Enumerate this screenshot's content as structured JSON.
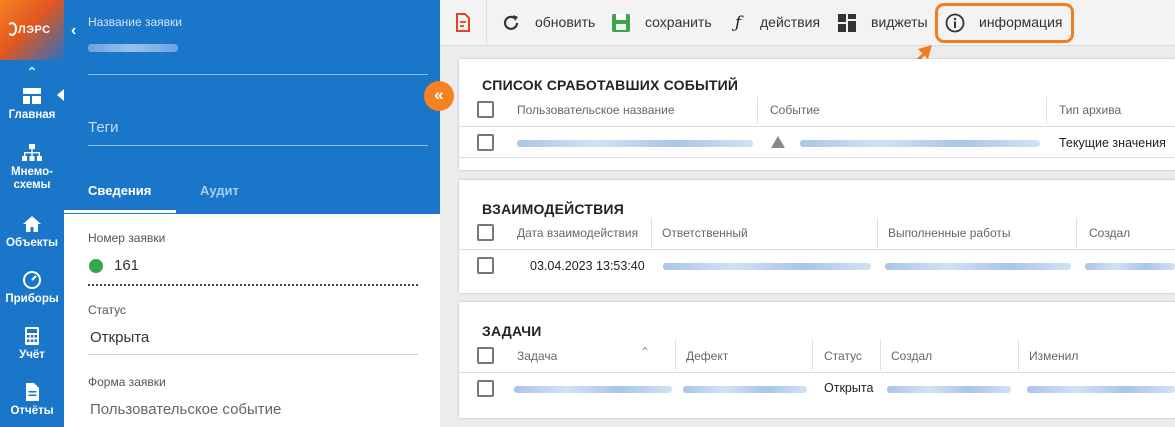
{
  "colors": {
    "primary": "#1976c8",
    "accent": "#f58220",
    "status_open": "#2fa84f",
    "highlight": "#f07d1e"
  },
  "logo": {
    "text": "ЛЭРС"
  },
  "nav": {
    "items": [
      {
        "label": "Главная",
        "icon": "dashboard-icon"
      },
      {
        "label": "Мнемо-схемы",
        "icon": "hierarchy-icon"
      },
      {
        "label": "Объекты",
        "icon": "home-icon"
      },
      {
        "label": "Приборы",
        "icon": "gauge-icon"
      },
      {
        "label": "Учёт",
        "icon": "calculator-icon"
      },
      {
        "label": "Отчёты",
        "icon": "document-icon"
      }
    ]
  },
  "panel": {
    "name_label": "Название заявки",
    "tags_placeholder": "Теги",
    "tabs": [
      "Сведения",
      "Аудит"
    ],
    "fields": {
      "number_label": "Номер заявки",
      "number_value": "161",
      "status_label": "Статус",
      "status_value": "Открыта",
      "form_label": "Форма заявки",
      "form_value": "Пользовательское событие"
    }
  },
  "toolbar": {
    "refresh": "обновить",
    "save": "сохранить",
    "actions": "действия",
    "widgets": "виджеты",
    "info": "информация"
  },
  "events_card": {
    "title": "СПИСОК СРАБОТАВШИХ СОБЫТИЙ",
    "columns": [
      "Пользовательское название",
      "Событие",
      "Тип архива"
    ],
    "rows": [
      {
        "archive_type": "Текущие значения"
      }
    ]
  },
  "interactions_card": {
    "title": "ВЗАИМОДЕЙСТВИЯ",
    "columns": [
      "Дата взаимодействия",
      "Ответственный",
      "Выполненные работы",
      "Создал"
    ],
    "rows": [
      {
        "date": "03.04.2023 13:53:40"
      }
    ]
  },
  "tasks_card": {
    "title": "ЗАДАЧИ",
    "columns": [
      "Задача",
      "Дефект",
      "Статус",
      "Создал",
      "Изменил"
    ],
    "rows": [
      {
        "status": "Открыта"
      }
    ]
  }
}
